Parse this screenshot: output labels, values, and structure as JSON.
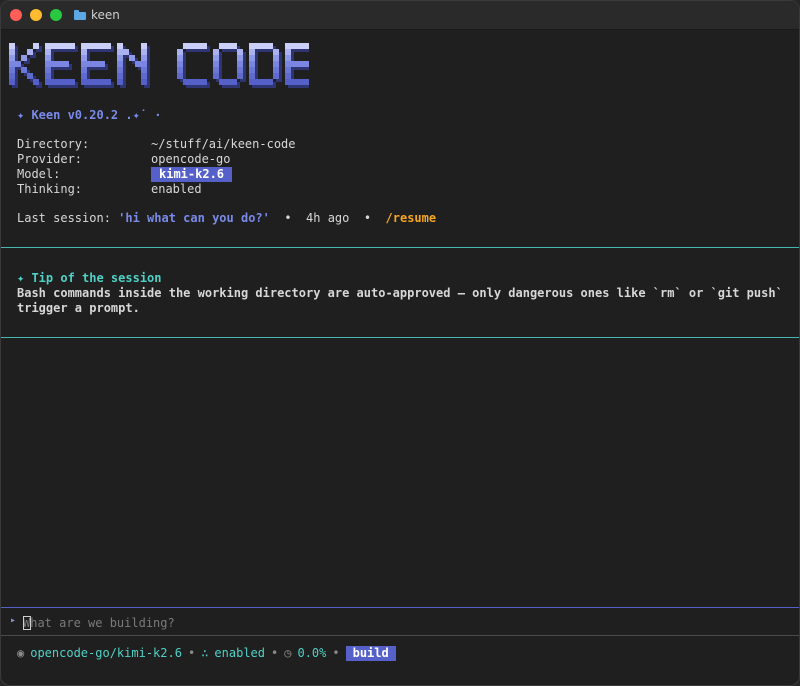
{
  "window": {
    "title": "keen"
  },
  "logo": {
    "text": "KEEN CODE"
  },
  "header": {
    "version_line": "✦ Keen v0.20.2 .✦˙ ·"
  },
  "info": {
    "directory_label": "Directory:",
    "directory_value": "~/stuff/ai/keen-code",
    "provider_label": "Provider:",
    "provider_value": "opencode-go",
    "model_label": "Model:",
    "model_value": "kimi-k2.6",
    "thinking_label": "Thinking:",
    "thinking_value": "enabled"
  },
  "session": {
    "label": "Last session:",
    "name": "'hi what can you do?'",
    "sep": "•",
    "age": "4h ago",
    "resume": "/resume"
  },
  "tip": {
    "title": "✦ Tip of the session",
    "line1": "Bash commands inside the working directory are auto-approved — only dangerous ones like `rm` or `git push`",
    "line2": "trigger a prompt."
  },
  "input": {
    "glyph": "▸",
    "placeholder": "What are we building?"
  },
  "status": {
    "provider_icon": "◉",
    "provider_model": "opencode-go/kimi-k2.6",
    "sep": "•",
    "thinking_icon": "∴",
    "thinking": "enabled",
    "context_icon": "◷",
    "context": "0.0%",
    "mode": "build"
  },
  "colors": {
    "accent": "#5561c9",
    "teal": "#4fd1c5",
    "orange": "#f5a524"
  }
}
